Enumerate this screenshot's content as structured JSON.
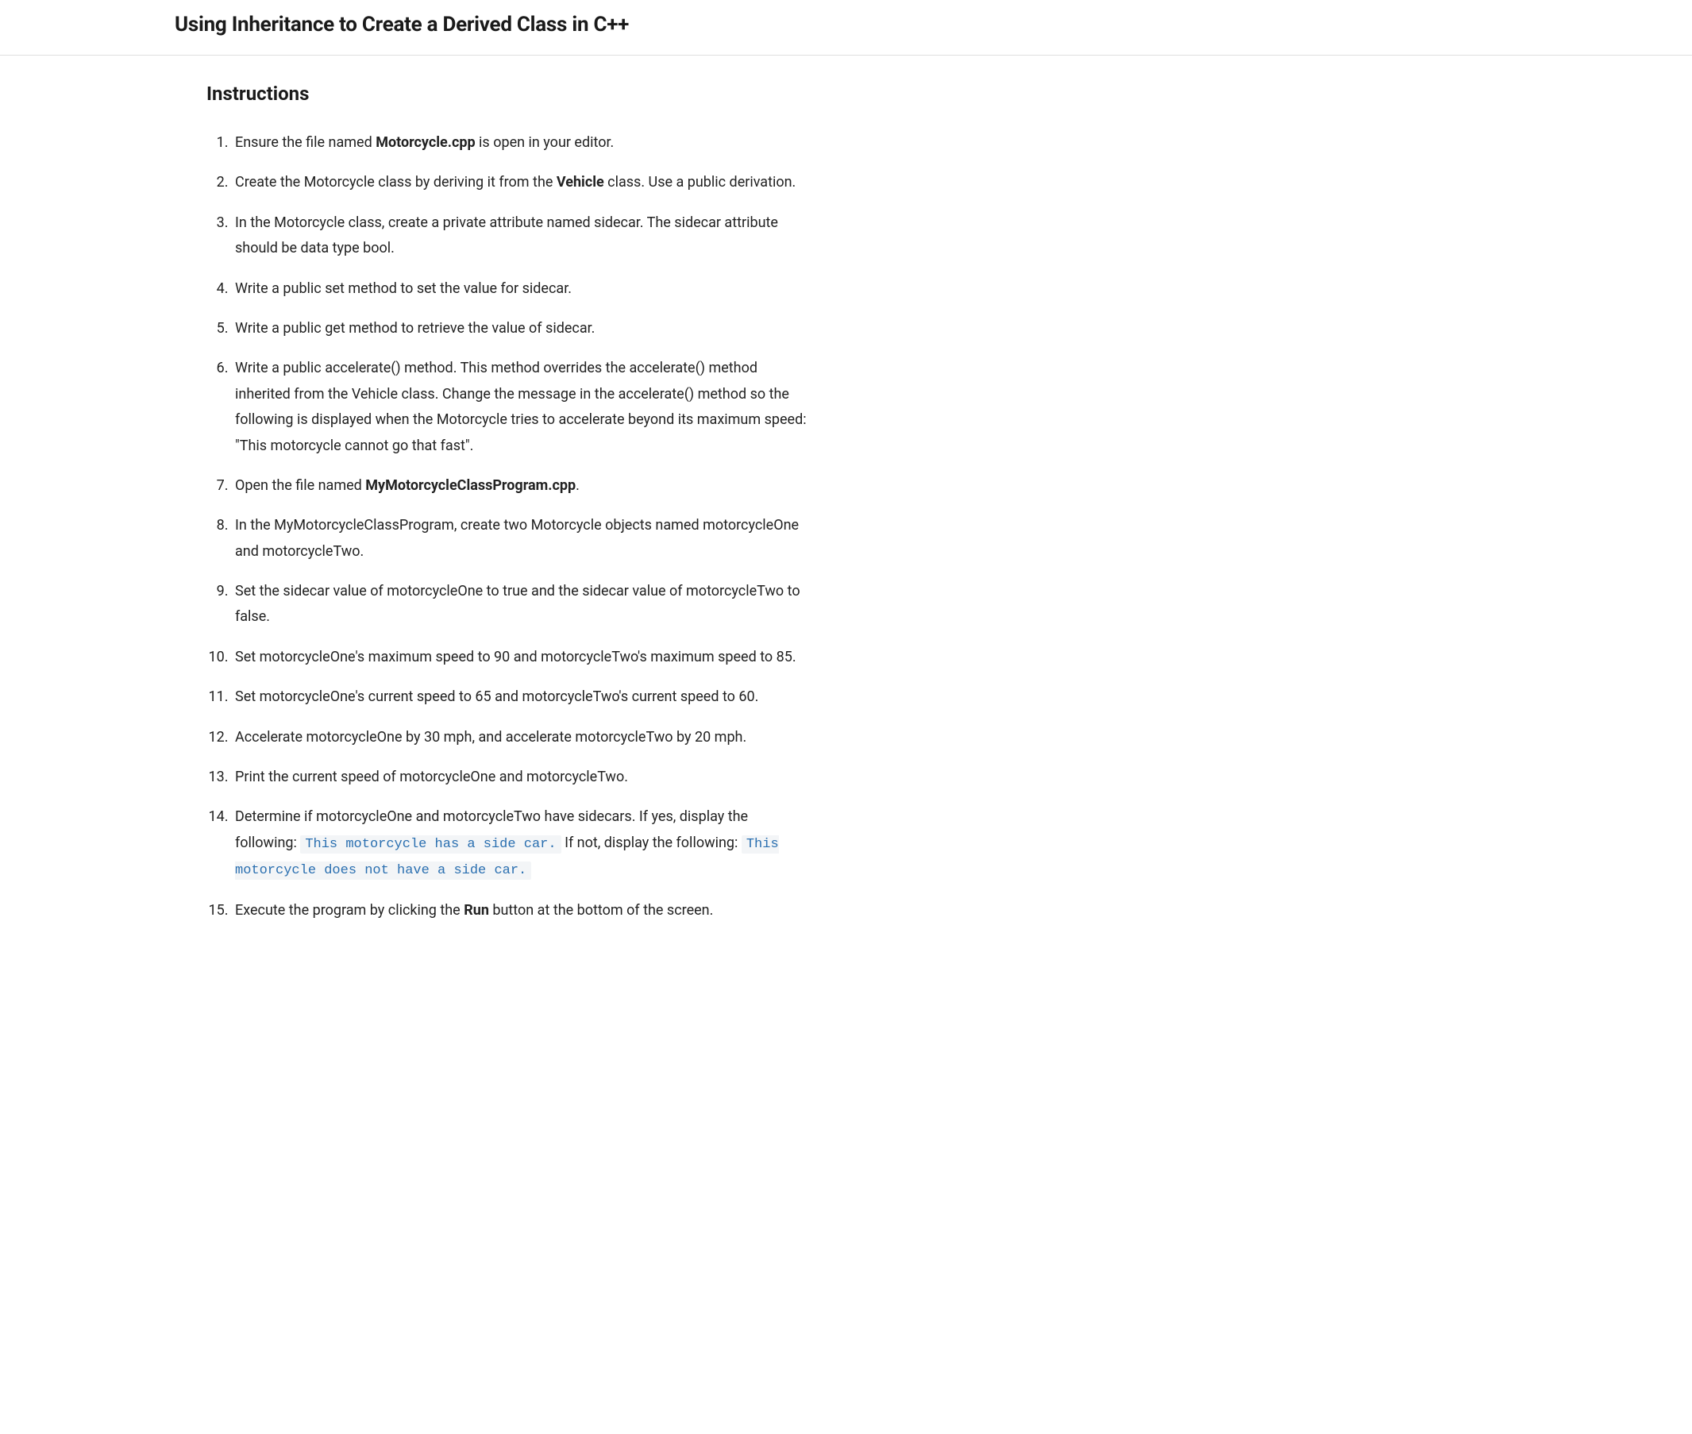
{
  "header": {
    "title": "Using Inheritance to Create a Derived Class in C++"
  },
  "section": {
    "heading": "Instructions"
  },
  "steps": [
    {
      "pre": "Ensure the file named ",
      "bold": "Motorcycle.cpp",
      "post": " is open in your editor."
    },
    {
      "pre": "Create the Motorcycle class by deriving it from the ",
      "bold": "Vehicle",
      "post": " class. Use a public derivation."
    },
    {
      "text": "In the Motorcycle class, create a private attribute named sidecar. The sidecar attribute should be data type bool."
    },
    {
      "text": "Write a public set method to set the value for sidecar."
    },
    {
      "text": "Write a public get method to retrieve the value of sidecar."
    },
    {
      "text": "Write a public accelerate() method. This method overrides the accelerate() method inherited from the Vehicle class. Change the message in the accelerate() method so the following is displayed when the Motorcycle tries to accelerate beyond its maximum speed: \"This motorcycle cannot go that fast\"."
    },
    {
      "pre": "Open the file named ",
      "bold": "MyMotorcycleClassProgram.cpp",
      "post": "."
    },
    {
      "text": "In the MyMotorcycleClassProgram, create two Motorcycle objects named motorcycleOne and motorcycleTwo."
    },
    {
      "text": "Set the sidecar value of motorcycleOne to true and the sidecar value of motorcycleTwo to false."
    },
    {
      "text": "Set motorcycleOne's maximum speed to 90 and motorcycleTwo's maximum speed to 85."
    },
    {
      "text": "Set motorcycleOne's current speed to 65 and motorcycleTwo's current speed to 60."
    },
    {
      "text": "Accelerate motorcycleOne by 30 mph, and accelerate motorcycleTwo by 20 mph."
    },
    {
      "text": "Print the current speed of motorcycleOne and motorcycleTwo."
    },
    {
      "text14_lead": "Determine if motorcycleOne and motorcycleTwo have sidecars. If yes, display the following: ",
      "code1": "This motorcycle has a side car.",
      "mid": " If not, display the following: ",
      "code2": "This motorcycle does not have a side car."
    },
    {
      "pre": "Execute the program by clicking the ",
      "bold": "Run",
      "post": " button at the bottom of the screen."
    }
  ]
}
